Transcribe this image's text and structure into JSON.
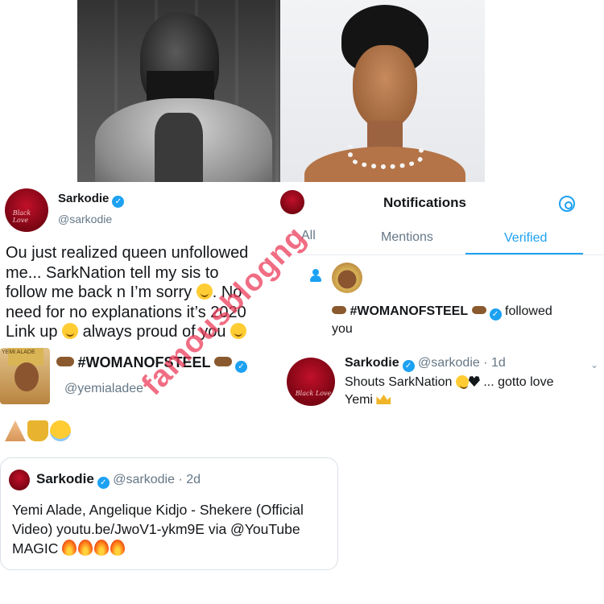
{
  "left_tweet": {
    "name": "Sarkodie",
    "handle": "@sarkodie",
    "avatar_caption": "Black Love",
    "text_lines": [
      "Ou just realized queen unfollowed",
      "me... SarkNation tell my sis to",
      "follow me back n I’m sorry",
      ". No",
      "need for no explanations it’s 2020",
      "Link up",
      "always proud of you"
    ],
    "embedded_profile": {
      "avatar_label": "YEMI ALADE",
      "display_name": "#WOMANOFSTEEL",
      "handle": "@yemialadee"
    }
  },
  "quoted_tweet": {
    "name": "Sarkodie",
    "handle": "@sarkodie",
    "age": "· 2d",
    "text_lines": [
      "Yemi Alade, Angelique Kidjo - Shekere (Official",
      "Video) youtu.be/JwoV1-ykm9E via @YouTube",
      "MAGIC"
    ]
  },
  "notifications": {
    "title": "Notifications",
    "tabs": [
      "All",
      "Mentions",
      "Verified"
    ],
    "active_tab": "Verified",
    "follow_event": {
      "who": "#WOMANOFSTEEL",
      "action": "followed",
      "object": "you"
    },
    "reply": {
      "name": "Sarkodie",
      "handle": "@sarkodie",
      "age": "· 1d",
      "line1_start": "Shouts SarkNation",
      "line1_end": "... gotto love",
      "line2": "Yemi"
    }
  },
  "watermark": "famousblogng",
  "colors": {
    "twitter_blue": "#1da1f2",
    "text": "#14171a",
    "muted": "#657786",
    "watermark": "#eb3c5a"
  }
}
